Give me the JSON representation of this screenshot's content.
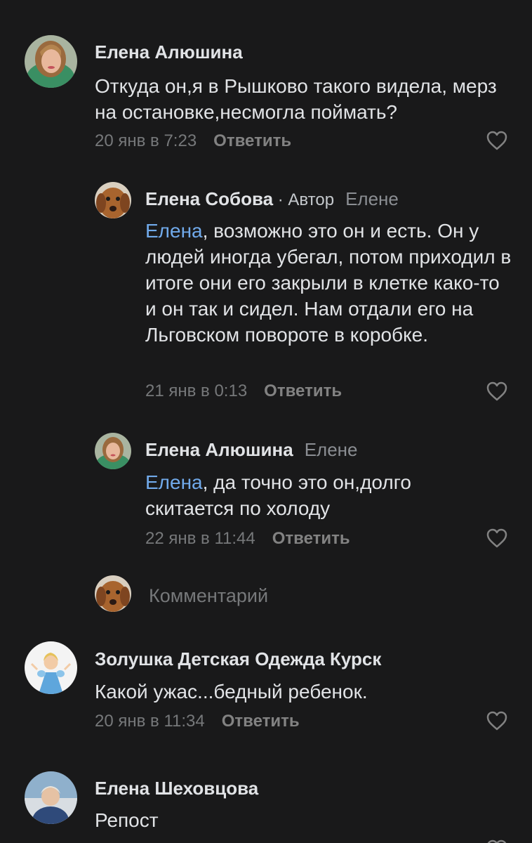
{
  "comments": [
    {
      "author": "Елена Алюшина",
      "text": "Откуда он,я в Рышково такого видела, мерз на остановке,несмогла поймать?",
      "time": "20 янв в 7:23",
      "reply_label": "Ответить"
    },
    {
      "author": "Елена Собова",
      "author_tag": " · Автор",
      "reply_to": "Елене",
      "mention": "Елена",
      "text": ", возможно это он и есть. Он у людей иногда убегал, потом приходил в итоге они его закрыли в клетке како-то и он так и сидел. Нам отдали его на Льговском повороте в коробке.",
      "time": "21 янв в 0:13",
      "reply_label": "Ответить"
    },
    {
      "author": "Елена Алюшина",
      "reply_to": "Елене",
      "mention": "Елена",
      "text": ", да точно это он,долго скитается по холоду",
      "time": "22 янв в 11:44",
      "reply_label": "Ответить"
    },
    {
      "author": "Золушка Детская Одежда Курск",
      "text": "Какой ужас...бедный ребенок.",
      "time": "20 янв в 11:34",
      "reply_label": "Ответить"
    },
    {
      "author": "Елена Шеховцова",
      "text": "Репост"
    }
  ],
  "reply_composer": {
    "placeholder": "Комментарий"
  },
  "colors": {
    "background": "#19191a",
    "text": "#e1e3e6",
    "secondary": "#76787a",
    "mention": "#71aaeb"
  },
  "icons": [
    "heart-outline-icon"
  ]
}
